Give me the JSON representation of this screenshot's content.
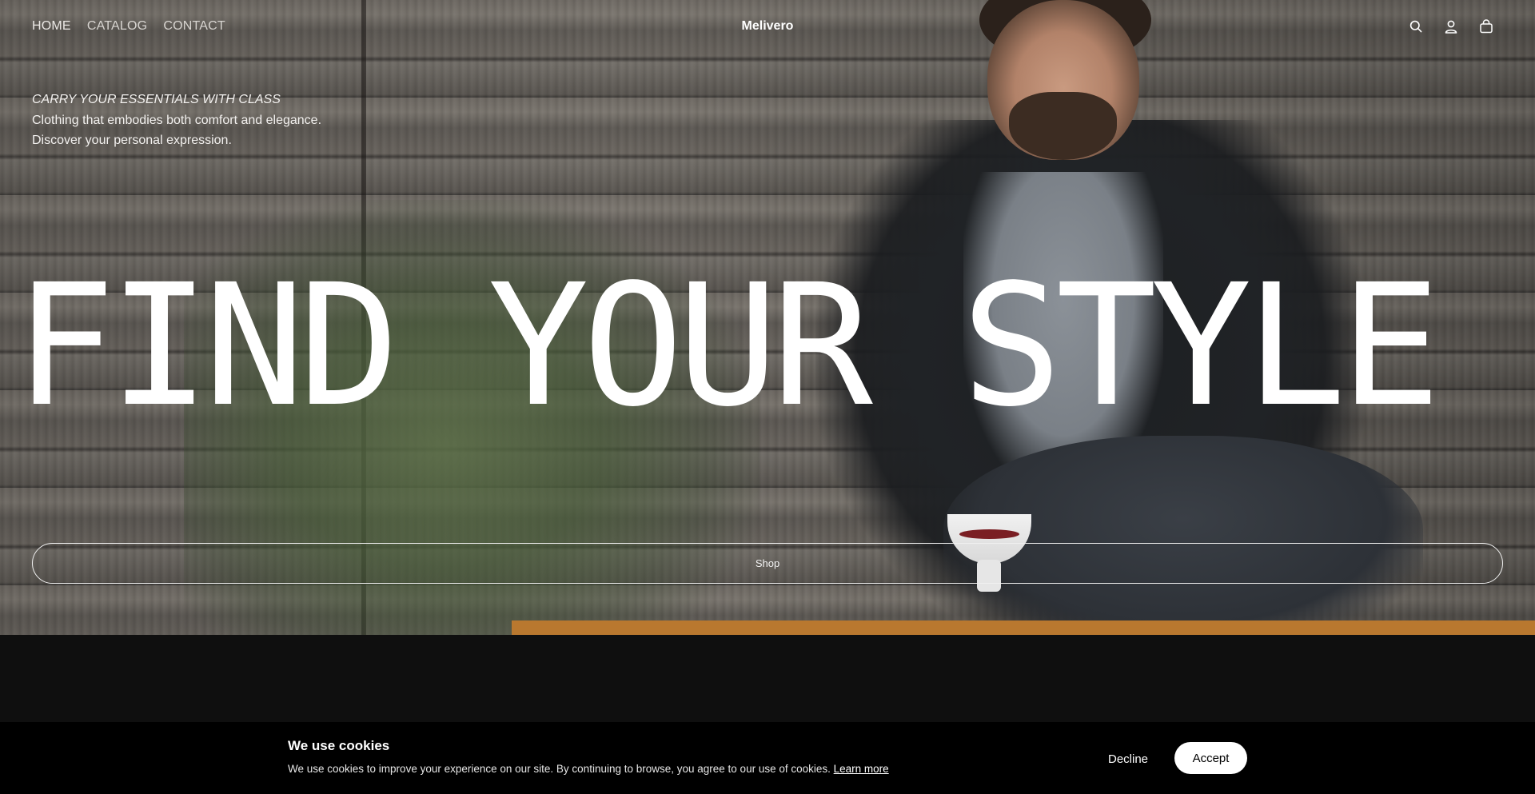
{
  "nav": {
    "links": [
      "HOME",
      "CATALOG",
      "CONTACT"
    ],
    "brand": "Melivero",
    "icons": [
      "search-icon",
      "account-icon",
      "cart-icon"
    ]
  },
  "hero": {
    "eyebrow": "CARRY YOUR ESSENTIALS WITH CLASS",
    "line1": "Clothing that embodies both comfort and elegance.",
    "line2": "Discover your personal expression.",
    "headline": "FIND YOUR STYLE",
    "shop_label": "Shop"
  },
  "cookie_banner": {
    "title": "We use cookies",
    "text": "We use cookies to improve your experience on our site. By continuing to browse, you agree to our use of cookies.",
    "learn_more": "Learn more",
    "decline": "Decline",
    "accept": "Accept"
  },
  "colors": {
    "background": "#0f0f0f",
    "banner": "#000000",
    "accept_button": "#ffffff"
  }
}
